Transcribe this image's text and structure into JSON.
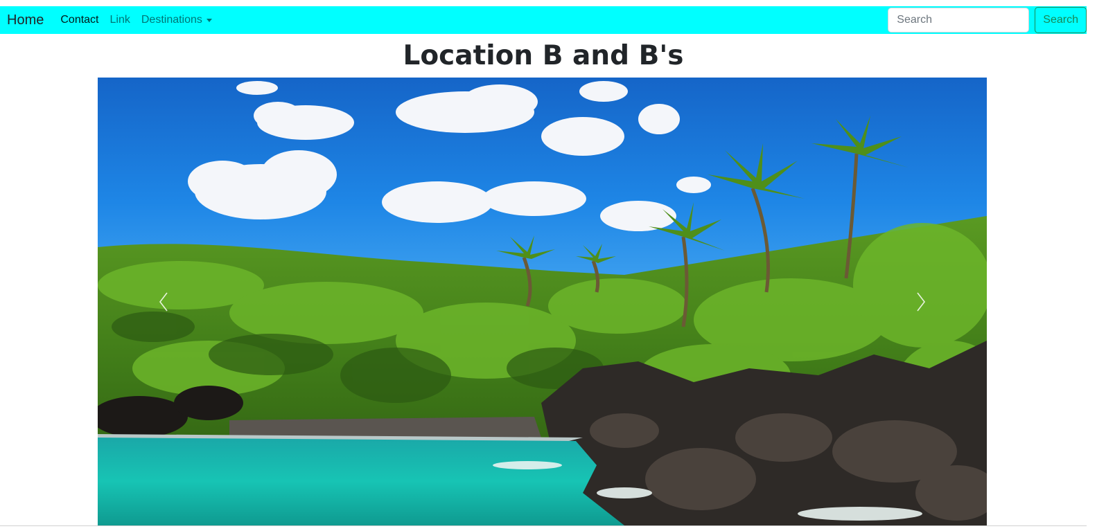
{
  "navbar": {
    "brand": "Home",
    "links": [
      {
        "label": "Contact"
      },
      {
        "label": "Link"
      },
      {
        "label": "Destinations"
      }
    ],
    "search": {
      "placeholder": "Search",
      "button_label": "Search"
    },
    "background_color": "#00ffff"
  },
  "main": {
    "title": "Location B and B's"
  },
  "carousel": {
    "prev_icon": "chevron-left-icon",
    "next_icon": "chevron-right-icon"
  }
}
